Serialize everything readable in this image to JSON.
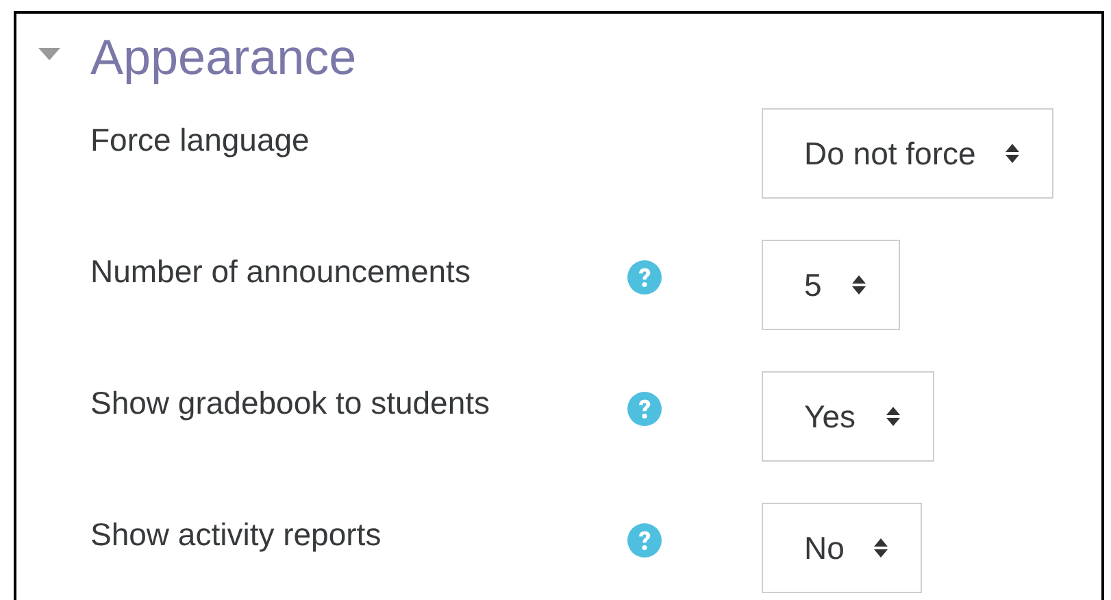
{
  "section": {
    "title": "Appearance",
    "expanded": true
  },
  "fields": [
    {
      "label": "Force language",
      "help": false,
      "value": "Do not force"
    },
    {
      "label": "Number of announcements",
      "help": true,
      "value": "5"
    },
    {
      "label": "Show gradebook to students",
      "help": true,
      "value": "Yes"
    },
    {
      "label": "Show activity reports",
      "help": true,
      "value": "No"
    }
  ]
}
